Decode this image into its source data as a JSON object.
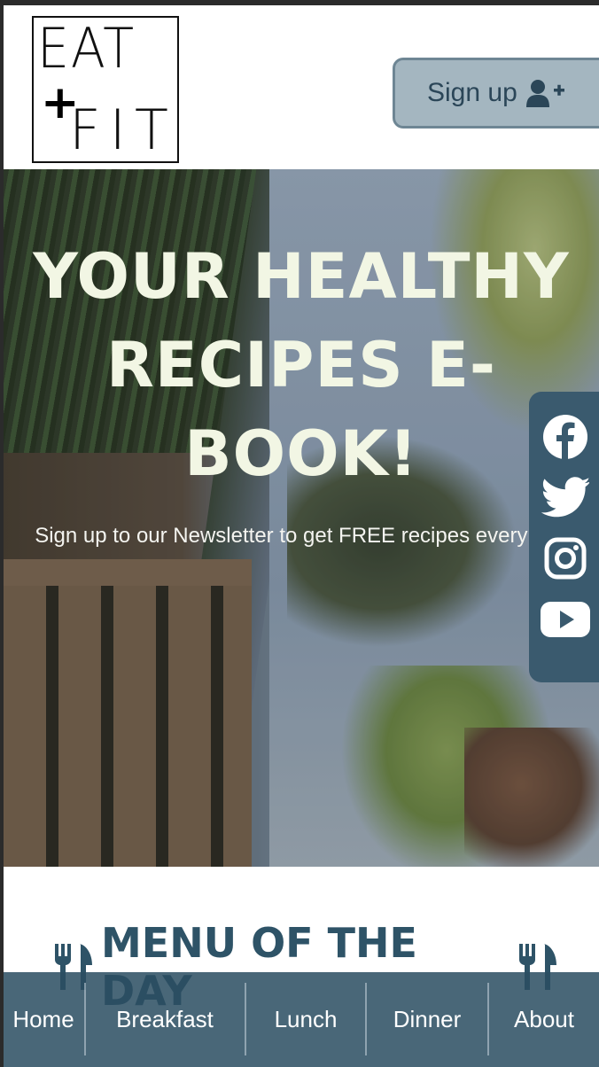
{
  "header": {
    "logo": {
      "line1": "EAT",
      "plus": "+",
      "line2": "FIT"
    },
    "signup": {
      "label": "Sign up",
      "icon": "user-plus-icon"
    }
  },
  "hero": {
    "title_line1": "YOUR HEALTHY",
    "title_line2": "RECIPES E-BOOK!",
    "subtitle": "Sign up to our Newsletter to get FREE recipes every day"
  },
  "social": {
    "items": [
      {
        "name": "facebook",
        "icon": "facebook-icon"
      },
      {
        "name": "twitter",
        "icon": "twitter-icon"
      },
      {
        "name": "instagram",
        "icon": "instagram-icon"
      },
      {
        "name": "youtube",
        "icon": "youtube-icon"
      }
    ]
  },
  "menu_of_day": {
    "title": "MENU OF THE DAY",
    "icon": "fork-knife-icon"
  },
  "bottom_nav": {
    "items": [
      {
        "label": "Home"
      },
      {
        "label": "Breakfast"
      },
      {
        "label": "Lunch"
      },
      {
        "label": "Dinner"
      },
      {
        "label": "About"
      }
    ]
  },
  "colors": {
    "accent_dark": "#2e5367",
    "nav_bg": "#2b4e62",
    "signup_bg": "#a4b6c0",
    "hero_text": "#f2f6e4"
  }
}
